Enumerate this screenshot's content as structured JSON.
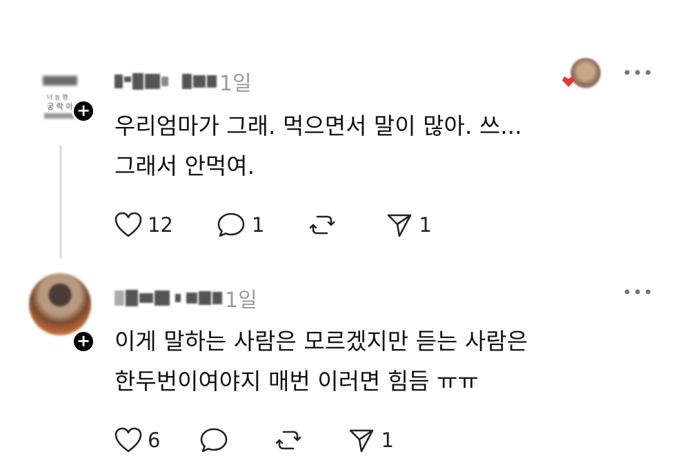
{
  "comments": [
    {
      "time": "1일",
      "text": "우리엄마가 그래. 먹으면서 말이 많아. 쓰...\n그래서 안먹여.",
      "likes": "12",
      "replies": "1",
      "reposts": "",
      "shares": "1",
      "avatar_caption_1": "너 능 명",
      "avatar_caption_2": "궁 락 이"
    },
    {
      "time": "1일",
      "text": "이게 말하는 사람은 모르겠지만 듣는 사람은\n한두번이여야지 매번 이러면 힘듬 ㅠㅠ",
      "likes": "6",
      "replies": "",
      "reposts": "",
      "shares": "1"
    }
  ],
  "colors": {
    "accent": "#000000",
    "muted": "#9b9b9b",
    "like_red": "#e53935"
  },
  "icons": [
    "heart-icon",
    "comment-icon",
    "repost-icon",
    "share-icon",
    "more-icon",
    "plus-icon"
  ]
}
